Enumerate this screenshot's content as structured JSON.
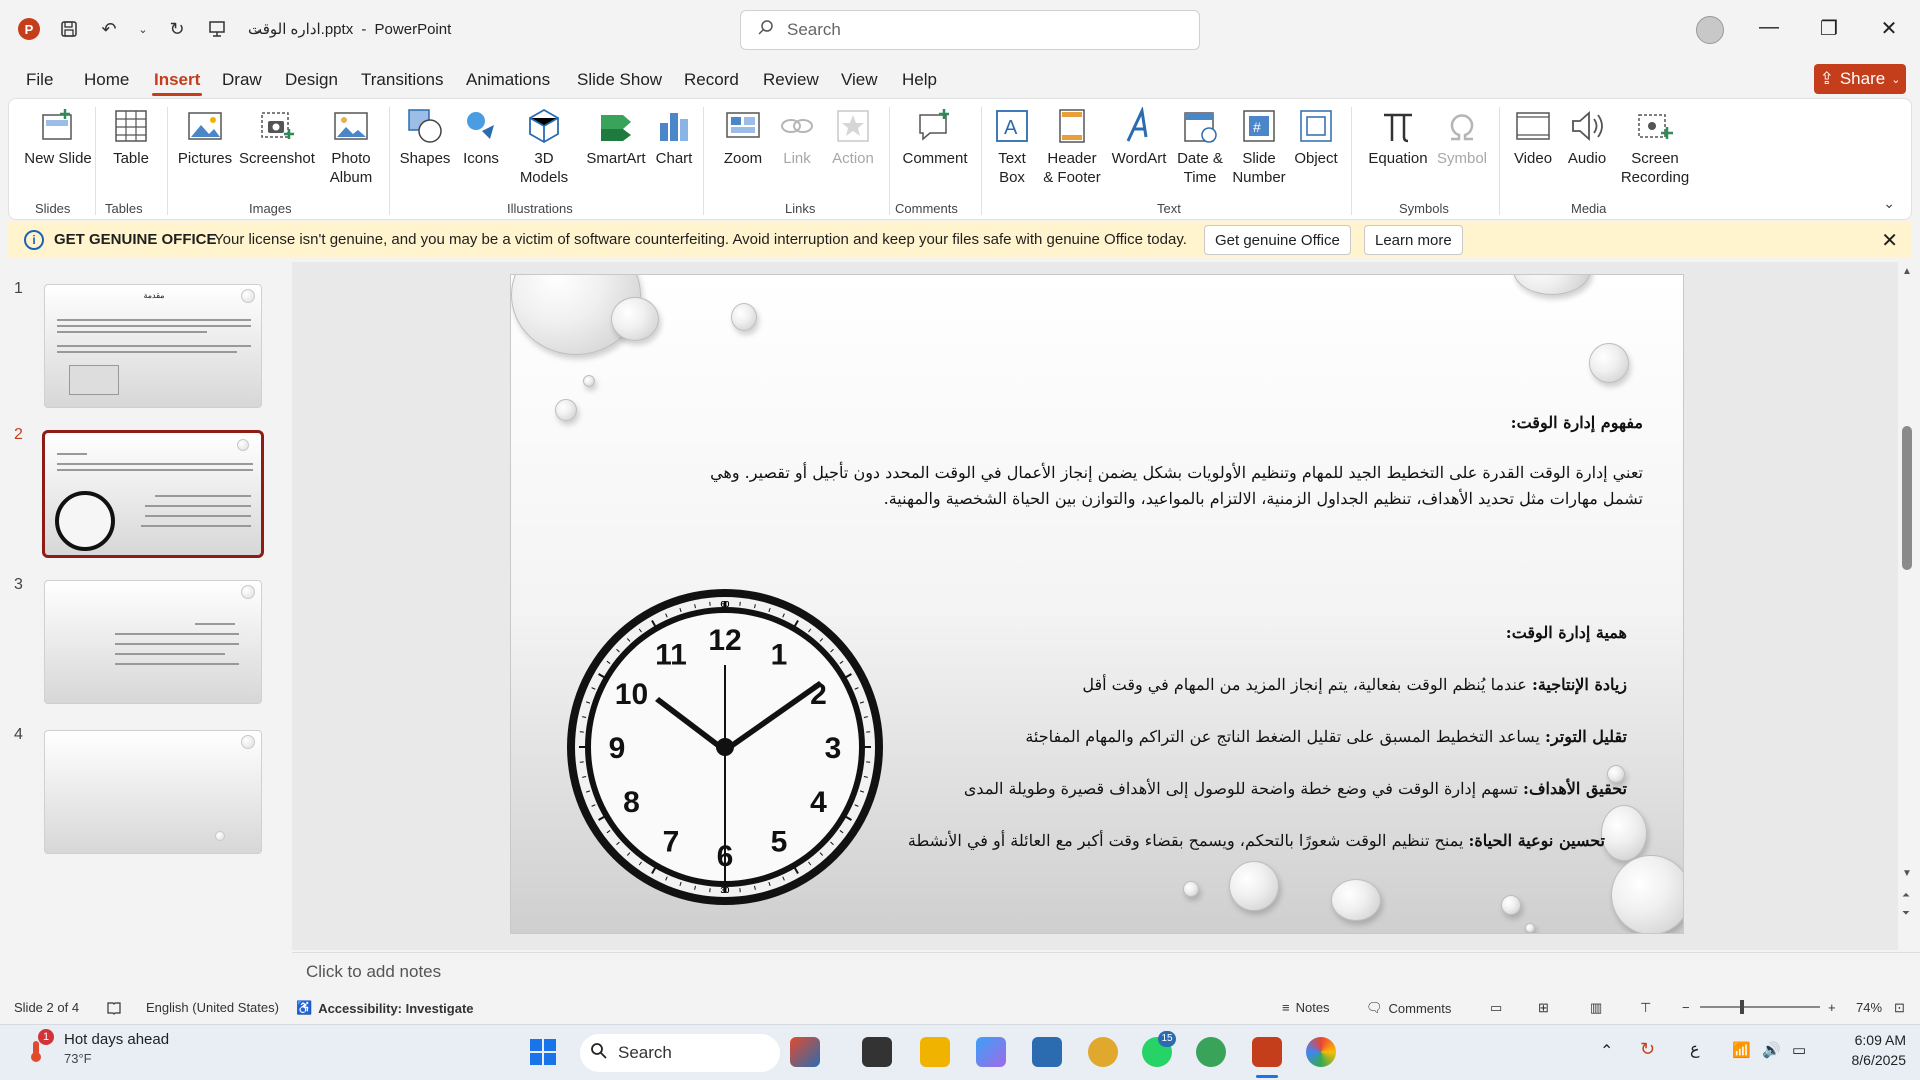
{
  "window": {
    "file_title": "اداره الوقت.pptx",
    "separator": "-",
    "app_name": "PowerPoint",
    "search_placeholder": "Search"
  },
  "menu": {
    "tabs": [
      "File",
      "Home",
      "Insert",
      "Draw",
      "Design",
      "Transitions",
      "Animations",
      "Slide Show",
      "Record",
      "Review",
      "View",
      "Help"
    ],
    "active": "Insert",
    "share_label": "Share"
  },
  "ribbon": {
    "new_slide": "New Slide",
    "table": "Table",
    "pictures": "Pictures",
    "screenshot": "Screenshot",
    "photo_album": "Photo Album",
    "shapes": "Shapes",
    "icons": "Icons",
    "models_3d": "3D Models",
    "smartart": "SmartArt",
    "chart": "Chart",
    "zoom": "Zoom",
    "link": "Link",
    "action": "Action",
    "comment": "Comment",
    "text_box": "Text Box",
    "header_footer": "Header & Footer",
    "wordart": "WordArt",
    "date_time": "Date & Time",
    "slide_number": "Slide Number",
    "object": "Object",
    "equation": "Equation",
    "symbol": "Symbol",
    "video": "Video",
    "audio": "Audio",
    "screen_recording": "Screen Recording",
    "groups": {
      "slides": "Slides",
      "tables": "Tables",
      "images": "Images",
      "illustrations": "Illustrations",
      "links": "Links",
      "comments": "Comments",
      "text": "Text",
      "symbols": "Symbols",
      "media": "Media"
    }
  },
  "license_bar": {
    "title": "GET GENUINE OFFICE",
    "message": "Your license isn't genuine, and you may be a victim of software counterfeiting. Avoid interruption and keep your files safe with genuine Office today.",
    "button_primary": "Get genuine Office",
    "button_secondary": "Learn more"
  },
  "thumbnails": {
    "numbers": [
      "1",
      "2",
      "3",
      "4"
    ],
    "active_index": 2,
    "slide1_title": "مقدمة"
  },
  "slide": {
    "heading1": "مفهوم إدارة الوقت:",
    "para1_line1": "تعني إدارة الوقت القدرة على التخطيط الجيد للمهام وتنظيم الأولويات بشكل يضمن إنجاز الأعمال في الوقت المحدد دون تأجيل أو تقصير. وهي",
    "para1_line2": "تشمل مهارات مثل تحديد الأهداف، تنظيم الجداول الزمنية، الالتزام بالمواعيد، والتوازن بين الحياة الشخصية والمهنية.",
    "heading2": "همية إدارة الوقت:",
    "items": [
      {
        "label": "زيادة الإنتاجية:",
        "text": " عندما يُنظم الوقت بفعالية، يتم إنجاز المزيد من المهام في وقت أقل"
      },
      {
        "label": "تقليل التوتر:",
        "text": " يساعد التخطيط المسبق على تقليل الضغط الناتج عن التراكم والمهام المفاجئة"
      },
      {
        "label": "تحقيق الأهداف:",
        "text": " تسهم إدارة الوقت في وضع خطة واضحة للوصول إلى الأهداف قصيرة وطويلة المدى"
      },
      {
        "label": "تحسين نوعية الحياة:",
        "text": " يمنح تنظيم الوقت شعورًا بالتحكم، ويسمح بقضاء وقت أكبر مع العائلة أو في الأنشطة"
      }
    ],
    "clock_numbers": [
      "12",
      "1",
      "2",
      "3",
      "4",
      "5",
      "6",
      "7",
      "8",
      "9",
      "10",
      "11"
    ],
    "clock_minute_marks": [
      "60",
      "30"
    ]
  },
  "notes": {
    "placeholder": "Click to add notes"
  },
  "status": {
    "slide_info": "Slide 2 of 4",
    "language": "English (United States)",
    "accessibility": "Accessibility: Investigate",
    "notes_label": "Notes",
    "comments_label": "Comments",
    "zoom": "74%"
  },
  "taskbar": {
    "weather_title": "Hot days ahead",
    "weather_temp": "73°F",
    "weather_badge": "1",
    "search_label": "Search",
    "whatsapp_badge": "15",
    "time": "6:09 AM",
    "date": "8/6/2025",
    "ime": "ع"
  },
  "colors": {
    "accent": "#c43e1c",
    "active_thumb_border": "#8e1c16",
    "license_bg": "#fff4ce"
  }
}
